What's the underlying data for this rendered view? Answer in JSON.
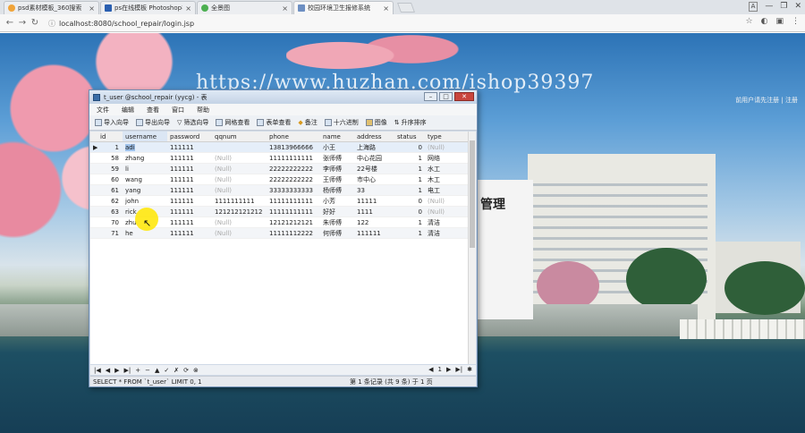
{
  "browser": {
    "tabs": [
      {
        "title": "psd素材模板_360搜索",
        "active": false,
        "color": "#f0a43a"
      },
      {
        "title": "ps在线模板 Photoshop在",
        "active": false,
        "color": "#2a5fb0"
      },
      {
        "title": "全景图",
        "active": false,
        "color": "#4caf50"
      },
      {
        "title": "校园环境卫生报修系统",
        "active": true,
        "color": "#6d8fc2"
      }
    ],
    "url": "localhost:8080/school_repair/login.jsp",
    "window_letter": "A"
  },
  "page": {
    "heading": "管理",
    "top_links": "前用户请先注册  | 注册",
    "watermark": "https://www.huzhan.com/ishop39397"
  },
  "db_window": {
    "title": "t_user @school_repair (yycg) - 表",
    "menu": [
      "文件",
      "编辑",
      "查看",
      "窗口",
      "帮助"
    ],
    "toolbar": [
      "导入向导",
      "导出向导",
      "筛选向导",
      "网格查看",
      "表单查看",
      "备注",
      "十六进制",
      "图像",
      "升序排序"
    ],
    "columns": [
      "id",
      "username",
      "password",
      "qqnum",
      "phone",
      "name",
      "address",
      "status",
      "type"
    ],
    "rows": [
      [
        "1",
        "adi",
        "111111",
        "",
        "13813966666",
        "小王",
        "上海路",
        "0",
        "(Null)"
      ],
      [
        "58",
        "zhang",
        "111111",
        "(Null)",
        "11111111111",
        "张师傅",
        "中心花园",
        "1",
        "网络"
      ],
      [
        "59",
        "li",
        "111111",
        "(Null)",
        "22222222222",
        "李师傅",
        "22号楼",
        "1",
        "水工"
      ],
      [
        "60",
        "wang",
        "111111",
        "(Null)",
        "22222222222",
        "王师傅",
        "市中心",
        "1",
        "木工"
      ],
      [
        "61",
        "yang",
        "111111",
        "(Null)",
        "33333333333",
        "杨师傅",
        "33",
        "1",
        "电工"
      ],
      [
        "62",
        "john",
        "111111",
        "1111111111",
        "11111111111",
        "小芳",
        "11111",
        "0",
        "(Null)"
      ],
      [
        "63",
        "rick",
        "111111",
        "121212121212",
        "11111111111",
        "好好",
        "1111",
        "0",
        "(Null)"
      ],
      [
        "70",
        "zhu",
        "111111",
        "(Null)",
        "12121212121",
        "朱师傅",
        "122",
        "1",
        "清洁"
      ],
      [
        "71",
        "he",
        "111111",
        "(Null)",
        "11111112222",
        "何师傅",
        "111111",
        "1",
        "清洁"
      ]
    ],
    "nav_buttons": [
      "|◀",
      "◀",
      "▶",
      "▶|",
      "+",
      "−",
      "▲",
      "✓",
      "✗",
      "⟳",
      "⊗"
    ],
    "page_indicator": "1",
    "sql": "SELECT * FROM `t_user` LIMIT 0, 1",
    "record_info": "第 1 条记录 (共 9 条) 于 1 页"
  }
}
